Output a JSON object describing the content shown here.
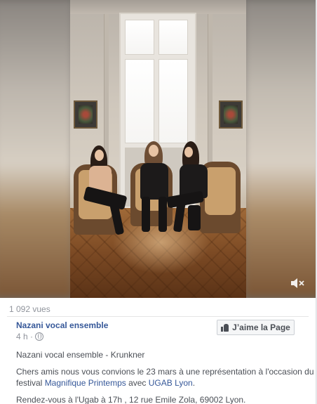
{
  "post": {
    "views": "1 092 vues",
    "page_name": "Nazani vocal ensemble",
    "timestamp": "4 h ·",
    "like_page_label": "J’aime la Page",
    "video_title": "Nazani vocal ensemble - Krunkner",
    "body_line1": "Chers amis nous vous convions le 23 mars à une représentation à l'occasion du",
    "body_line2_prefix": "festival ",
    "body_link1": "Magnifique Printemps",
    "body_line2_mid": " avec ",
    "body_link2": "UGAB Lyon",
    "body_line2_suffix": ".",
    "body_line3": "Rendez-vous à l'Ugab à 17h , 12 rue Emile Zola, 69002 Lyon."
  },
  "icons": {
    "volume": "volume-muted-icon",
    "globe": "globe-icon",
    "like": "thumbs-up-icon"
  },
  "colors": {
    "link": "#365899",
    "meta_text": "#90949c",
    "body_text": "#4b4f56"
  }
}
